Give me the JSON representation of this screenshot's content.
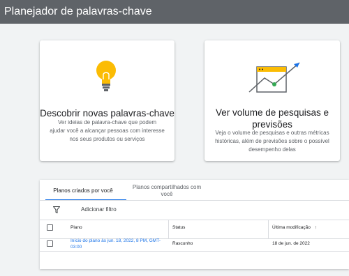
{
  "header": {
    "title": "Planejador de palavras-chave"
  },
  "cards": [
    {
      "title": "Descobrir novas palavras-chave",
      "description": "Ver ideias de palavra-chave que podem ajudar você a alcançar pessoas com interesse nos seus produtos ou serviços",
      "icon": "lightbulb-icon"
    },
    {
      "title": "Ver volume de pesquisas e previsões",
      "description": "Veja o volume de pesquisas e outras métricas históricas, além de previsões sobre o possível desempenho delas",
      "icon": "chart-trend-icon"
    }
  ],
  "plans": {
    "tabs": [
      {
        "label": "Planos criados por você",
        "active": true
      },
      {
        "label": "Planos compartilhados com você",
        "active": false
      }
    ],
    "filter_label": "Adicionar filtro",
    "columns": [
      "Plano",
      "Status",
      "Última modificação"
    ],
    "sort_indicator": "↑",
    "rows": [
      {
        "plan": "Início do plano às jun. 18, 2022, 8 PM, GMT-03:00",
        "status": "Rascunho",
        "modified": "18 de jun. de 2022"
      }
    ]
  },
  "colors": {
    "accent": "#1a73e8",
    "topbar": "#5f6368",
    "bulb": "#fbbc04",
    "check": "#34a853"
  }
}
